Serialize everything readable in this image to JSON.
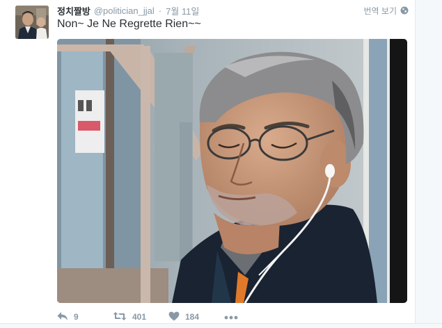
{
  "tweet": {
    "display_name": "정치짤방",
    "screen_name": "@politician_jjal",
    "separator": "·",
    "timestamp": "7월 11일",
    "translate_label": "번역 보기",
    "text": "Non~ Je Ne Regrette Rien~~",
    "avatar_icon": "profile-photo",
    "media_icon": "photo-man-with-earphones"
  },
  "actions": {
    "reply": {
      "icon": "reply-icon",
      "count": "9"
    },
    "retweet": {
      "icon": "retweet-icon",
      "count": "401"
    },
    "like": {
      "icon": "heart-icon",
      "count": "184"
    },
    "more": {
      "icon": "more-icon"
    }
  },
  "colors": {
    "text": "#292f33",
    "muted": "#8899a6",
    "border": "#e1e8ed"
  }
}
